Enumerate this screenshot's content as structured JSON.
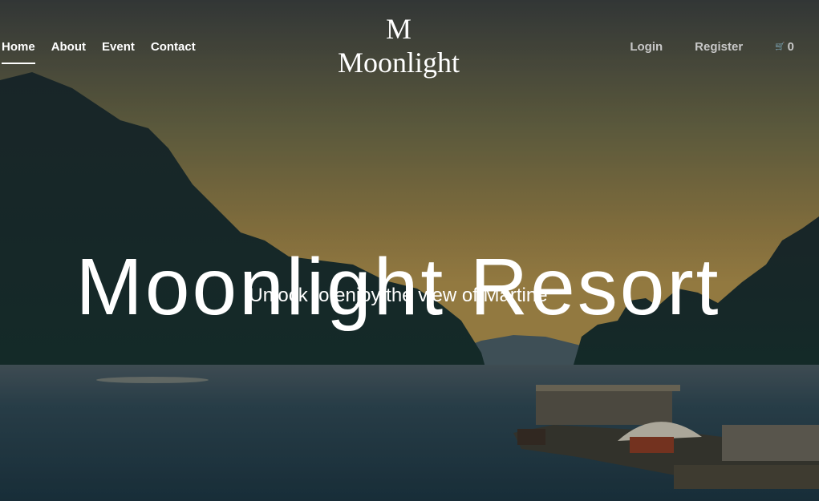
{
  "nav": {
    "left_links": [
      {
        "label": "Home",
        "active": true
      },
      {
        "label": "About"
      },
      {
        "label": "Event"
      },
      {
        "label": "Contact"
      }
    ],
    "brand": {
      "mark": "M",
      "name": "Moonlight"
    },
    "login_label": "Login",
    "register_label": "Register",
    "cart": {
      "icon": "cart-icon",
      "count": "0"
    }
  },
  "hero": {
    "title": "Moonlight Resort",
    "subtitle": "Unlock to enjoy the view of Martine"
  },
  "colors": {
    "text": "#ffffff",
    "muted_text": "#c8c8c8",
    "sky_top": "#3d4440",
    "sky_glow": "#b7923f",
    "water": "#26404b"
  }
}
